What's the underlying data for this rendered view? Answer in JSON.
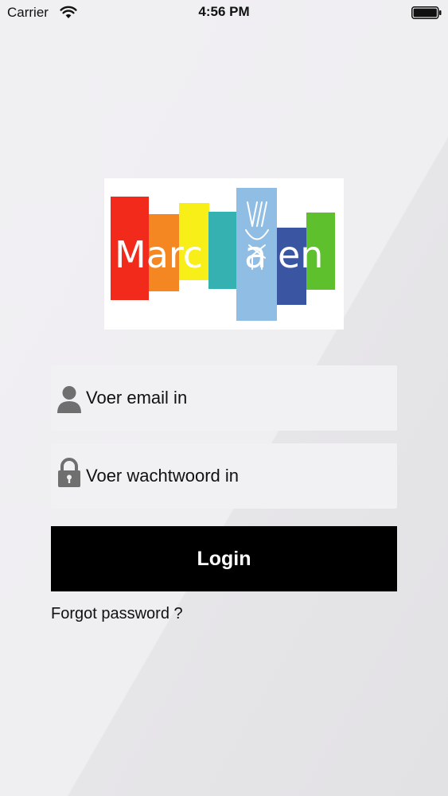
{
  "status_bar": {
    "carrier": "Carrier",
    "time": "4:56 PM",
    "wifi_icon": "wifi-icon",
    "battery_icon": "battery-full-icon"
  },
  "logo": {
    "text": "Marcaen",
    "bar_colors": [
      "#f22a1c",
      "#f48721",
      "#f9ef18",
      "#35b1b1",
      "#8fbde4",
      "#3a56a3",
      "#5fc02d"
    ]
  },
  "login_form": {
    "email_placeholder": "Voer email in",
    "email_icon": "user-icon",
    "password_placeholder": "Voer wachtwoord in",
    "password_icon": "lock-icon",
    "login_label": "Login",
    "forgot_password_label": "Forgot password ?"
  },
  "colors": {
    "login_button_bg": "#000000",
    "login_button_text": "#ffffff",
    "field_bg": "#f1f0f3",
    "icon_gray": "#6f6f70"
  }
}
